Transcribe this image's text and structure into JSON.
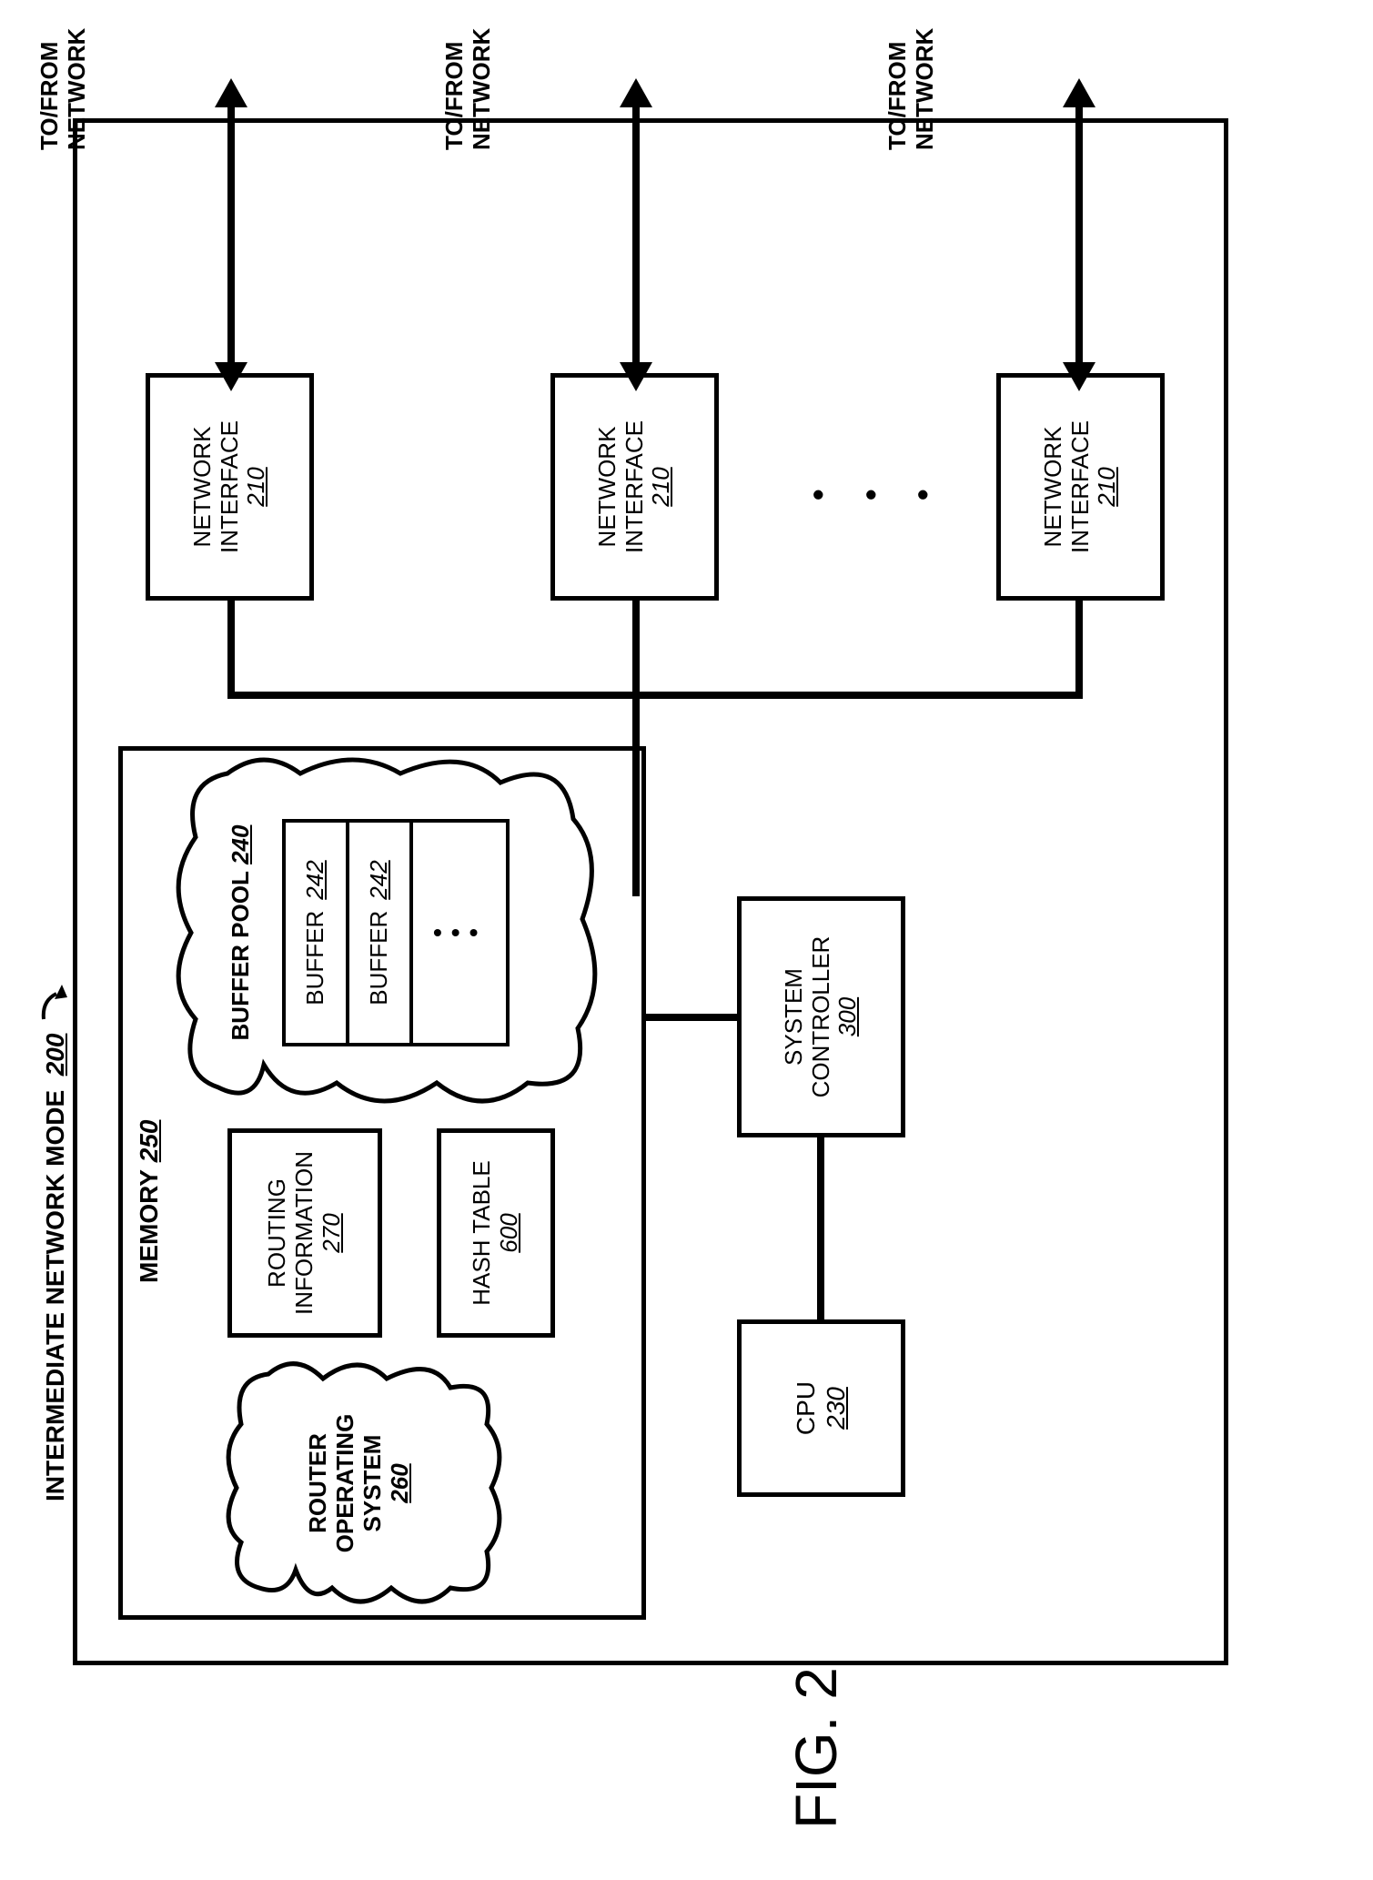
{
  "figure_caption": "FIG. 2",
  "title": {
    "text": "INTERMEDIATE NETWORK MODE",
    "num": "200"
  },
  "outer": {},
  "memory": {
    "label": "MEMORY",
    "num": "250"
  },
  "ros": {
    "l1": "ROUTER",
    "l2": "OPERATING",
    "l3": "SYSTEM",
    "num": "260"
  },
  "routing": {
    "l1": "ROUTING",
    "l2": "INFORMATION",
    "num": "270"
  },
  "hash": {
    "label": "HASH TABLE",
    "num": "600"
  },
  "bpool": {
    "label": "BUFFER POOL",
    "num": "240"
  },
  "buffer1": {
    "label": "BUFFER",
    "num": "242"
  },
  "buffer2": {
    "label": "BUFFER",
    "num": "242"
  },
  "cpu": {
    "label": "CPU",
    "num": "230"
  },
  "sysctl": {
    "l1": "SYSTEM",
    "l2": "CONTROLLER",
    "num": "300"
  },
  "nif1": {
    "l1": "NETWORK",
    "l2": "INTERFACE",
    "num": "210"
  },
  "nif2": {
    "l1": "NETWORK",
    "l2": "INTERFACE",
    "num": "210"
  },
  "nif3": {
    "l1": "NETWORK",
    "l2": "INTERFACE",
    "num": "210"
  },
  "net": {
    "l1": "TO/FROM",
    "l2": "NETWORK"
  }
}
